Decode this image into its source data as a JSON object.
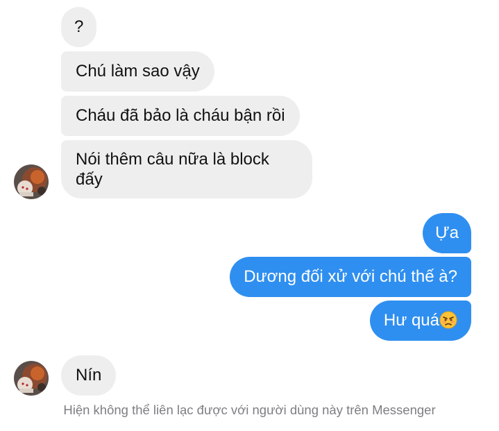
{
  "conversation": {
    "received_group_1": [
      {
        "text": "?"
      },
      {
        "text": "Chú làm sao vậy"
      },
      {
        "text": "Cháu đã bảo là cháu bận rồi"
      },
      {
        "text": "Nói thêm câu nữa là block đấy"
      }
    ],
    "sent_group": [
      {
        "text": "Ựa"
      },
      {
        "text": "Dương đối xử với chú thế à?"
      },
      {
        "text": "Hư quá",
        "emoji": "angry-face-emoji"
      }
    ],
    "received_group_2": [
      {
        "text": "Nín"
      }
    ]
  },
  "footer": {
    "notice": "Hiện không thể liên lạc được với người dùng này trên Messenger"
  },
  "colors": {
    "sent_bubble": "#2f8ff0",
    "received_bubble": "#eeeeef",
    "notice_text": "#7d7e82"
  }
}
